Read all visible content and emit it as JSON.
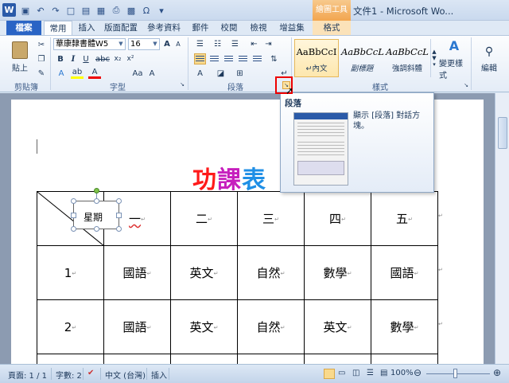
{
  "titlebar": {
    "app_icon": "W",
    "context_tab_header": "繪圖工具",
    "title": "文件1 - Microsoft Wo..."
  },
  "tabs": [
    "檔案",
    "常用",
    "插入",
    "版面配置",
    "參考資料",
    "郵件",
    "校閱",
    "檢視",
    "增益集",
    "格式"
  ],
  "ribbon": {
    "clipboard": {
      "paste": "貼上",
      "label": "剪貼簿"
    },
    "font": {
      "name": "華康隸書體W5",
      "size": "16",
      "label": "字型"
    },
    "paragraph": {
      "label": "段落"
    },
    "styles": {
      "label": "樣式",
      "items": [
        {
          "sample": "AaBbCcI",
          "name": "↵內文"
        },
        {
          "sample": "AaBbCcL",
          "name": "副標題"
        },
        {
          "sample": "AaBbCcL",
          "name": "強調斜體"
        }
      ],
      "change_styles": "變更樣式"
    },
    "editing": {
      "label": "編輯"
    }
  },
  "document": {
    "title_chars": [
      "功",
      "課",
      "表"
    ],
    "corner_label": "星期",
    "columns": [
      "一",
      "二",
      "三",
      "四",
      "五"
    ],
    "rows": [
      {
        "period": "1",
        "cells": [
          "國語",
          "英文",
          "自然",
          "數學",
          "國語"
        ]
      },
      {
        "period": "2",
        "cells": [
          "國語",
          "英文",
          "自然",
          "英文",
          "數學"
        ]
      }
    ]
  },
  "tooltip": {
    "title": "段落",
    "description": "顯示 [段落] 對話方塊。"
  },
  "statusbar": {
    "page": "頁面: 1 / 1",
    "words": "字數: 2",
    "language": "中文 (台灣)",
    "mode": "插入",
    "zoom": "100%"
  },
  "colors": {
    "file_tab": "#2a64c5",
    "title_red": "#ff1a1a",
    "title_purple": "#c61fbd",
    "title_blue": "#1f8fe6",
    "highlight": "#e00000"
  }
}
